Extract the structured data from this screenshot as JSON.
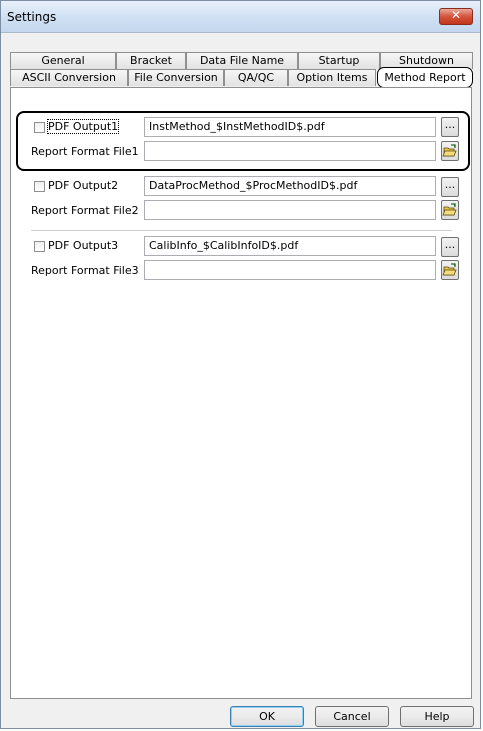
{
  "window": {
    "title": "Settings",
    "close_glyph": "✕"
  },
  "tabs": {
    "back_row": [
      {
        "label": "General"
      },
      {
        "label": "Bracket"
      },
      {
        "label": "Data File Name"
      },
      {
        "label": "Startup"
      },
      {
        "label": "Shutdown"
      }
    ],
    "front_row": [
      {
        "label": "ASCII Conversion"
      },
      {
        "label": "File Conversion"
      },
      {
        "label": "QA/QC"
      },
      {
        "label": "Option Items"
      },
      {
        "label": "Method Report",
        "active": true
      }
    ]
  },
  "groups": [
    {
      "checkbox_label": "PDF Output1",
      "checked": false,
      "pdf_value": "InstMethod_$InstMethodID$.pdf",
      "format_label": "Report Format File1",
      "format_value": ""
    },
    {
      "checkbox_label": "PDF Output2",
      "checked": false,
      "pdf_value": "DataProcMethod_$ProcMethodID$.pdf",
      "format_label": "Report Format File2",
      "format_value": ""
    },
    {
      "checkbox_label": "PDF Output3",
      "checked": false,
      "pdf_value": "CalibInfo_$CalibInfoID$.pdf",
      "format_label": "Report Format File3",
      "format_value": ""
    }
  ],
  "browse_label": "...",
  "buttons": {
    "ok": "OK",
    "cancel": "Cancel",
    "help": "Help"
  }
}
